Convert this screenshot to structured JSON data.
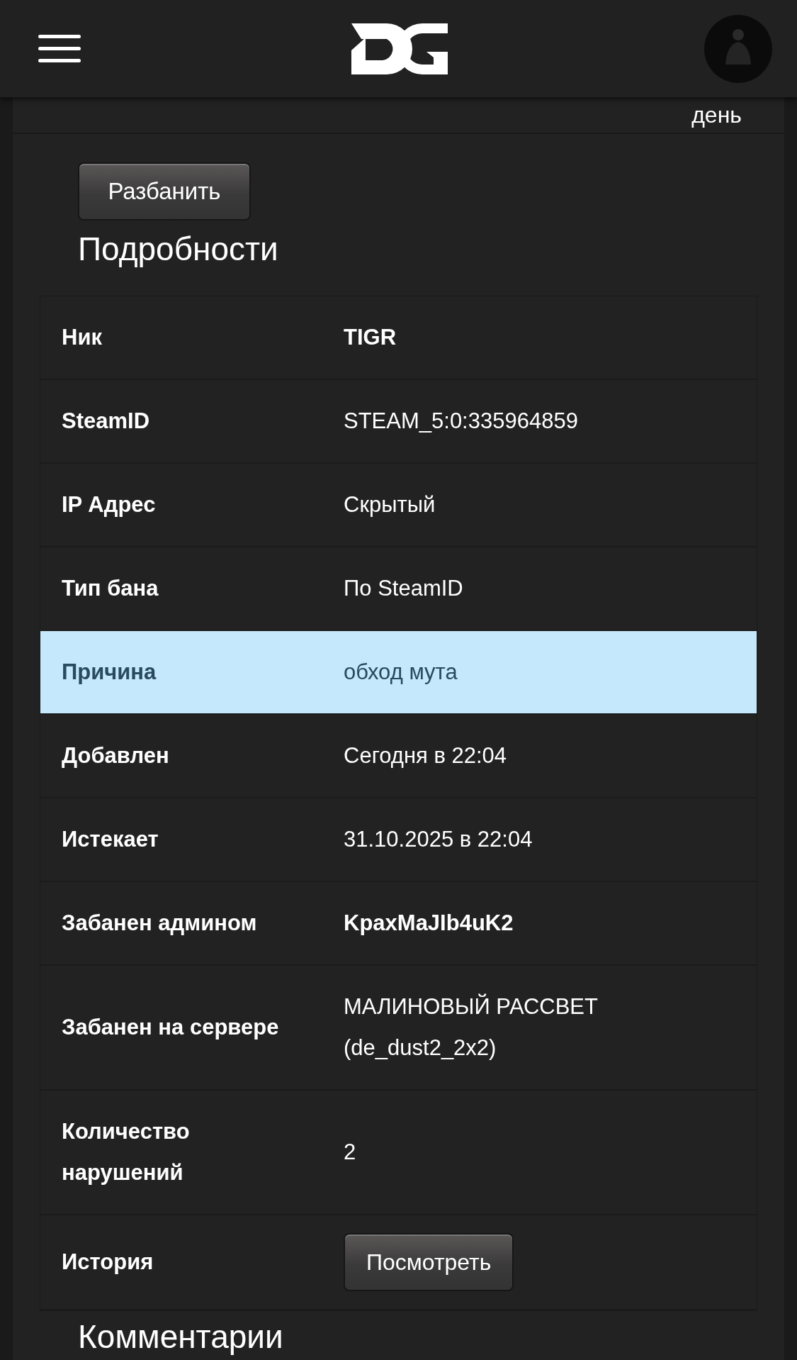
{
  "top_strip": {
    "text": "день"
  },
  "unban_button": "Разбанить",
  "details_heading": "Подробности",
  "rows": [
    {
      "label": "Ник",
      "value": "TIGR",
      "kind": "strong",
      "selected": false
    },
    {
      "label": "SteamID",
      "value": "STEAM_5:0:335964859",
      "kind": "text",
      "selected": false
    },
    {
      "label": "IP Адрес",
      "value": "Скрытый",
      "kind": "text",
      "selected": false
    },
    {
      "label": "Тип бана",
      "value": "По SteamID",
      "kind": "text",
      "selected": false
    },
    {
      "label": "Причина",
      "value": "обход мута",
      "kind": "text",
      "selected": true
    },
    {
      "label": "Добавлен",
      "value": "Сегодня в 22:04",
      "kind": "text",
      "selected": false
    },
    {
      "label": "Истекает",
      "value": "31.10.2025 в 22:04",
      "kind": "text",
      "selected": false
    },
    {
      "label": "Забанен админом",
      "value": "KpaxMaJIb4uK2",
      "kind": "strong",
      "selected": false
    },
    {
      "label": "Забанен на сервере",
      "value": "МАЛИНОВЫЙ РАССВЕТ (de_dust2_2x2)",
      "kind": "text",
      "selected": false
    },
    {
      "label": "Количество нарушений",
      "value": "2",
      "kind": "text",
      "selected": false
    },
    {
      "label": "История",
      "value": "Посмотреть",
      "kind": "button",
      "selected": false
    }
  ],
  "comments_heading": "Комментарии"
}
